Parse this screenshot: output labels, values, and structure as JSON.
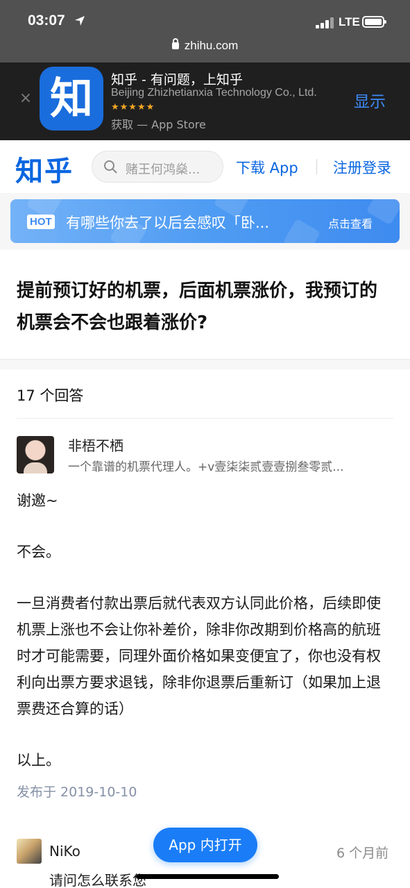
{
  "status_bar": {
    "time": "03:07",
    "network": "LTE"
  },
  "url_bar": {
    "domain": "zhihu.com"
  },
  "app_banner": {
    "close_glyph": "×",
    "icon_char": "知",
    "title": "知乎 - 有问题，上知乎",
    "developer": "Beijing Zhizhetianxia Technology Co., Ltd.",
    "stars": "★★★★★",
    "get_label": "获取 — App Store",
    "show_label": "显示"
  },
  "header": {
    "logo": "知乎",
    "search_placeholder": "赌王何鸿燊...",
    "download_label": "下载 App",
    "register_label": "注册登录"
  },
  "hot_banner": {
    "badge": "HOT",
    "text": "有哪些你去了以后会感叹「卧...",
    "cta": "点击查看"
  },
  "question": {
    "title": "提前预订好的机票，后面机票涨价，我预订的机票会不会也跟着涨价?"
  },
  "answers": {
    "count_label": "17 个回答",
    "first": {
      "author_name": "非梧不栖",
      "author_bio": "一个靠谱的机票代理人。+v壹柒柒贰壹壹捌叁零贰...",
      "paragraphs": [
        "谢邀~",
        "不会。",
        "一旦消费者付款出票后就代表双方认同此价格，后续即使机票上涨也不会让你补差价，除非你改期到价格高的航班时才可能需要，同理外面价格如果变便宜了，你也没有权利向出票方要求退钱，除非你退票后重新订（如果加上退票费还合算的话）",
        "以上。"
      ],
      "date": "发布于 2019-10-10"
    },
    "comment": {
      "name": "NiKo",
      "time": "6 个月前",
      "text": "请问怎么联系您"
    }
  },
  "floating_button": {
    "label": "App 内打开"
  },
  "colors": {
    "brand_blue": "#0a66e0",
    "ios_link_blue": "#3d8af7",
    "float_button_blue": "#1a7df7",
    "meta_gray": "#8590a6"
  }
}
